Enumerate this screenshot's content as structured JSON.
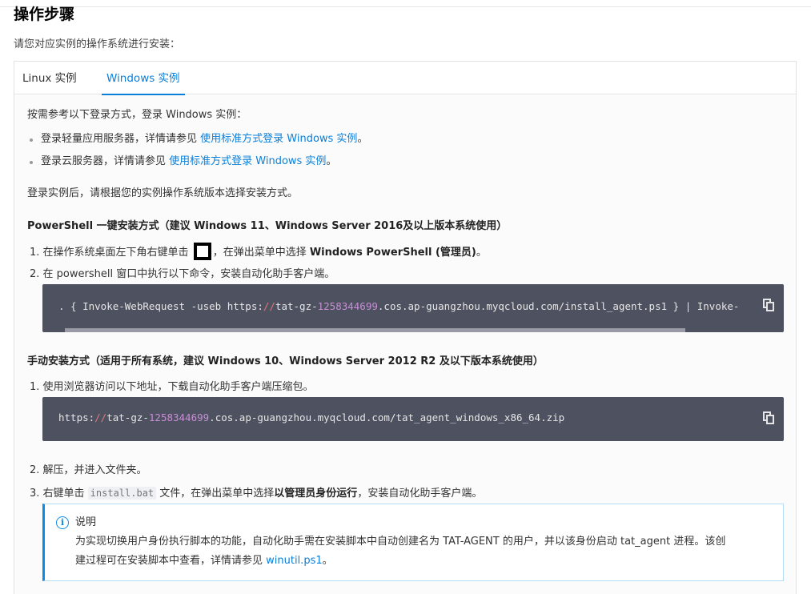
{
  "page": {
    "title": "操作步骤",
    "intro": "请您对应实例的操作系统进行安装："
  },
  "tabs": [
    {
      "label": "Linux 实例",
      "active": false
    },
    {
      "label": "Windows 实例",
      "active": true
    }
  ],
  "panel": {
    "login_intro": "按需参考以下登录方式，登录 Windows 实例：",
    "login_items": [
      {
        "text": "登录轻量应用服务器，详情请参见 ",
        "link": "使用标准方式登录 Windows 实例",
        "end": "。"
      },
      {
        "text": "登录云服务器，详情请参见 ",
        "link": "使用标准方式登录 Windows 实例",
        "end": "。"
      }
    ],
    "after_login": "登录实例后，请根据您的实例操作系统版本选择安装方式。",
    "powershell": {
      "heading": "PowerShell 一键安装方式（建议 Windows 11、Windows Server 2016及以上版本系统使用）",
      "step1_pre": "1. 在操作系统桌面左下角右键单击",
      "step1_post": "，在弹出菜单中选择",
      "step1_bold": "Windows PowerShell (管理员)",
      "step1_end": "。",
      "step2": "2. 在 powershell 窗口中执行以下命令，安装自动化助手客户端。",
      "code": {
        "p1": ". { Invoke-WebRequest -useb https:",
        "slash": "//",
        "p2": "tat-gz-",
        "num": "1258344699",
        "p3": ".cos.ap-guangzhou.myqcloud.com/install_agent.ps1 } | Invoke-"
      }
    },
    "manual": {
      "heading": "手动安装方式（适用于所有系统，建议 Windows 10、Windows Server 2012 R2 及以下版本系统使用）",
      "step1": "1. 使用浏览器访问以下地址，下载自动化助手客户端压缩包。",
      "code": {
        "p1": "https:",
        "slash": "//",
        "p2": "tat-gz-",
        "num": "1258344699",
        "p3": ".cos.ap-guangzhou.myqcloud.com/tat_agent_windows_x86_64.zip"
      },
      "step2": "2. 解压，并进入文件夹。",
      "step3_pre": "3. 右键单击 ",
      "step3_code": "install.bat",
      "step3_mid": " 文件，在弹出菜单中选择",
      "step3_bold": "以管理员身份运行",
      "step3_end": "，安装自动化助手客户端。"
    },
    "note": {
      "title": "说明",
      "line1": "为实现切换用户身份执行脚本的功能，自动化助手需在安装脚本中自动创建名为 TAT-AGENT 的用户，并以该身份启动 tat_agent 进程。该创",
      "line2_pre": "建过程可在安装脚本中查看，详情请参见 ",
      "line2_link": "winutil.ps1",
      "line2_end": "。"
    }
  },
  "colors": {
    "accent": "#0a7fd9",
    "code_bg": "#4d5160",
    "note_border": "#0a8ce6"
  }
}
